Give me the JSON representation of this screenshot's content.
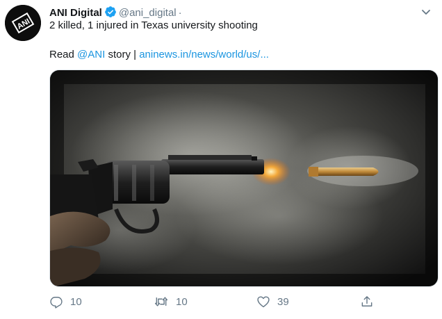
{
  "tweet": {
    "avatar_text": "ANI",
    "name": "ANI Digital",
    "handle": "@ani_digital",
    "dot": "·",
    "text_line1": "2 killed, 1 injured in Texas university shooting",
    "read_prefix": "Read",
    "mention": "@ANI",
    "story_text": "story |",
    "link": "aninews.in/news/world/us/..."
  },
  "actions": {
    "reply_count": "10",
    "retweet_count": "10",
    "like_count": "39"
  },
  "colors": {
    "link": "#1b95e0",
    "verified": "#1da1f2",
    "muted": "#657786"
  },
  "icons": [
    "verified-badge-icon",
    "chevron-down-icon",
    "reply-icon",
    "retweet-icon",
    "like-icon",
    "share-icon"
  ]
}
